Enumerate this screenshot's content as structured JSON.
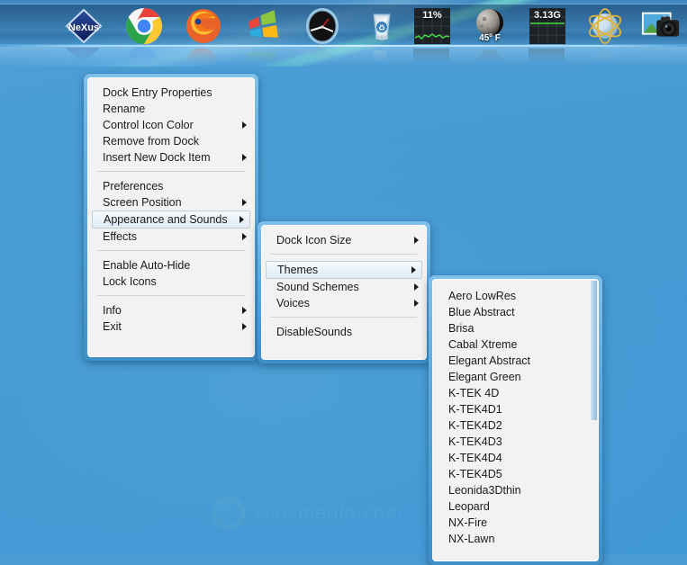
{
  "desktop": {
    "background_color": "#4a9ad4",
    "watermark_text": "winxmedia.com"
  },
  "dock": {
    "name": "Nexus Dock",
    "items": [
      {
        "id": "nexus",
        "label": "Nexus",
        "icon": "nexus-logo-icon",
        "value": ""
      },
      {
        "id": "chrome",
        "label": "Google Chrome",
        "icon": "chrome-icon",
        "value": ""
      },
      {
        "id": "firefox",
        "label": "Mozilla Firefox",
        "icon": "firefox-icon",
        "value": ""
      },
      {
        "id": "windows",
        "label": "Windows",
        "icon": "windows-logo-icon",
        "value": ""
      },
      {
        "id": "clock",
        "label": "Clock",
        "icon": "analog-clock-icon",
        "value": ""
      },
      {
        "id": "recyclebin",
        "label": "Recycle Bin",
        "icon": "recycle-bin-icon",
        "value": ""
      },
      {
        "id": "cpu",
        "label": "CPU Meter",
        "icon": "cpu-monitor-icon",
        "value": "11%"
      },
      {
        "id": "weather",
        "label": "Weather",
        "icon": "moon-weather-icon",
        "value": "45º F"
      },
      {
        "id": "memory",
        "label": "Memory Meter",
        "icon": "memory-monitor-icon",
        "value": "3.13G"
      },
      {
        "id": "network",
        "label": "Network",
        "icon": "globe-network-icon",
        "value": ""
      },
      {
        "id": "photos",
        "label": "Photos",
        "icon": "camera-photo-icon",
        "value": ""
      }
    ]
  },
  "menu_dock_entry": {
    "name": "Dock entry context menu",
    "groups": [
      [
        {
          "label": "Dock Entry Properties",
          "submenu": false,
          "selected": false
        },
        {
          "label": "Rename",
          "submenu": false,
          "selected": false
        },
        {
          "label": "Control Icon Color",
          "submenu": true,
          "selected": false
        },
        {
          "label": "Remove from Dock",
          "submenu": false,
          "selected": false
        },
        {
          "label": "Insert New Dock Item",
          "submenu": true,
          "selected": false
        }
      ],
      [
        {
          "label": "Preferences",
          "submenu": false,
          "selected": false
        },
        {
          "label": "Screen Position",
          "submenu": true,
          "selected": false
        },
        {
          "label": "Appearance and Sounds",
          "submenu": true,
          "selected": true
        },
        {
          "label": "Effects",
          "submenu": true,
          "selected": false
        }
      ],
      [
        {
          "label": "Enable Auto-Hide",
          "submenu": false,
          "selected": false
        },
        {
          "label": "Lock Icons",
          "submenu": false,
          "selected": false
        }
      ],
      [
        {
          "label": "Info",
          "submenu": true,
          "selected": false
        },
        {
          "label": "Exit",
          "submenu": true,
          "selected": false
        }
      ]
    ]
  },
  "menu_appearance": {
    "name": "Appearance and Sounds submenu",
    "groups": [
      [
        {
          "label": "Dock Icon Size",
          "submenu": true,
          "selected": false
        }
      ],
      [
        {
          "label": "Themes",
          "submenu": true,
          "selected": true
        },
        {
          "label": "Sound Schemes",
          "submenu": true,
          "selected": false
        },
        {
          "label": "Voices",
          "submenu": true,
          "selected": false
        }
      ],
      [
        {
          "label": "DisableSounds",
          "submenu": false,
          "selected": false
        }
      ]
    ]
  },
  "menu_themes": {
    "name": "Themes submenu",
    "scroll_visible": true,
    "items": [
      {
        "label": "Aero LowRes"
      },
      {
        "label": "Blue Abstract"
      },
      {
        "label": "Brisa"
      },
      {
        "label": "Cabal Xtreme"
      },
      {
        "label": "Elegant Abstract"
      },
      {
        "label": "Elegant Green"
      },
      {
        "label": "K-TEK 4D"
      },
      {
        "label": "K-TEK4D1"
      },
      {
        "label": "K-TEK4D2"
      },
      {
        "label": "K-TEK4D3"
      },
      {
        "label": "K-TEK4D4"
      },
      {
        "label": "K-TEK4D5"
      },
      {
        "label": "Leonida3Dthin"
      },
      {
        "label": "Leopard"
      },
      {
        "label": "NX-Fire"
      },
      {
        "label": "NX-Lawn"
      }
    ]
  }
}
